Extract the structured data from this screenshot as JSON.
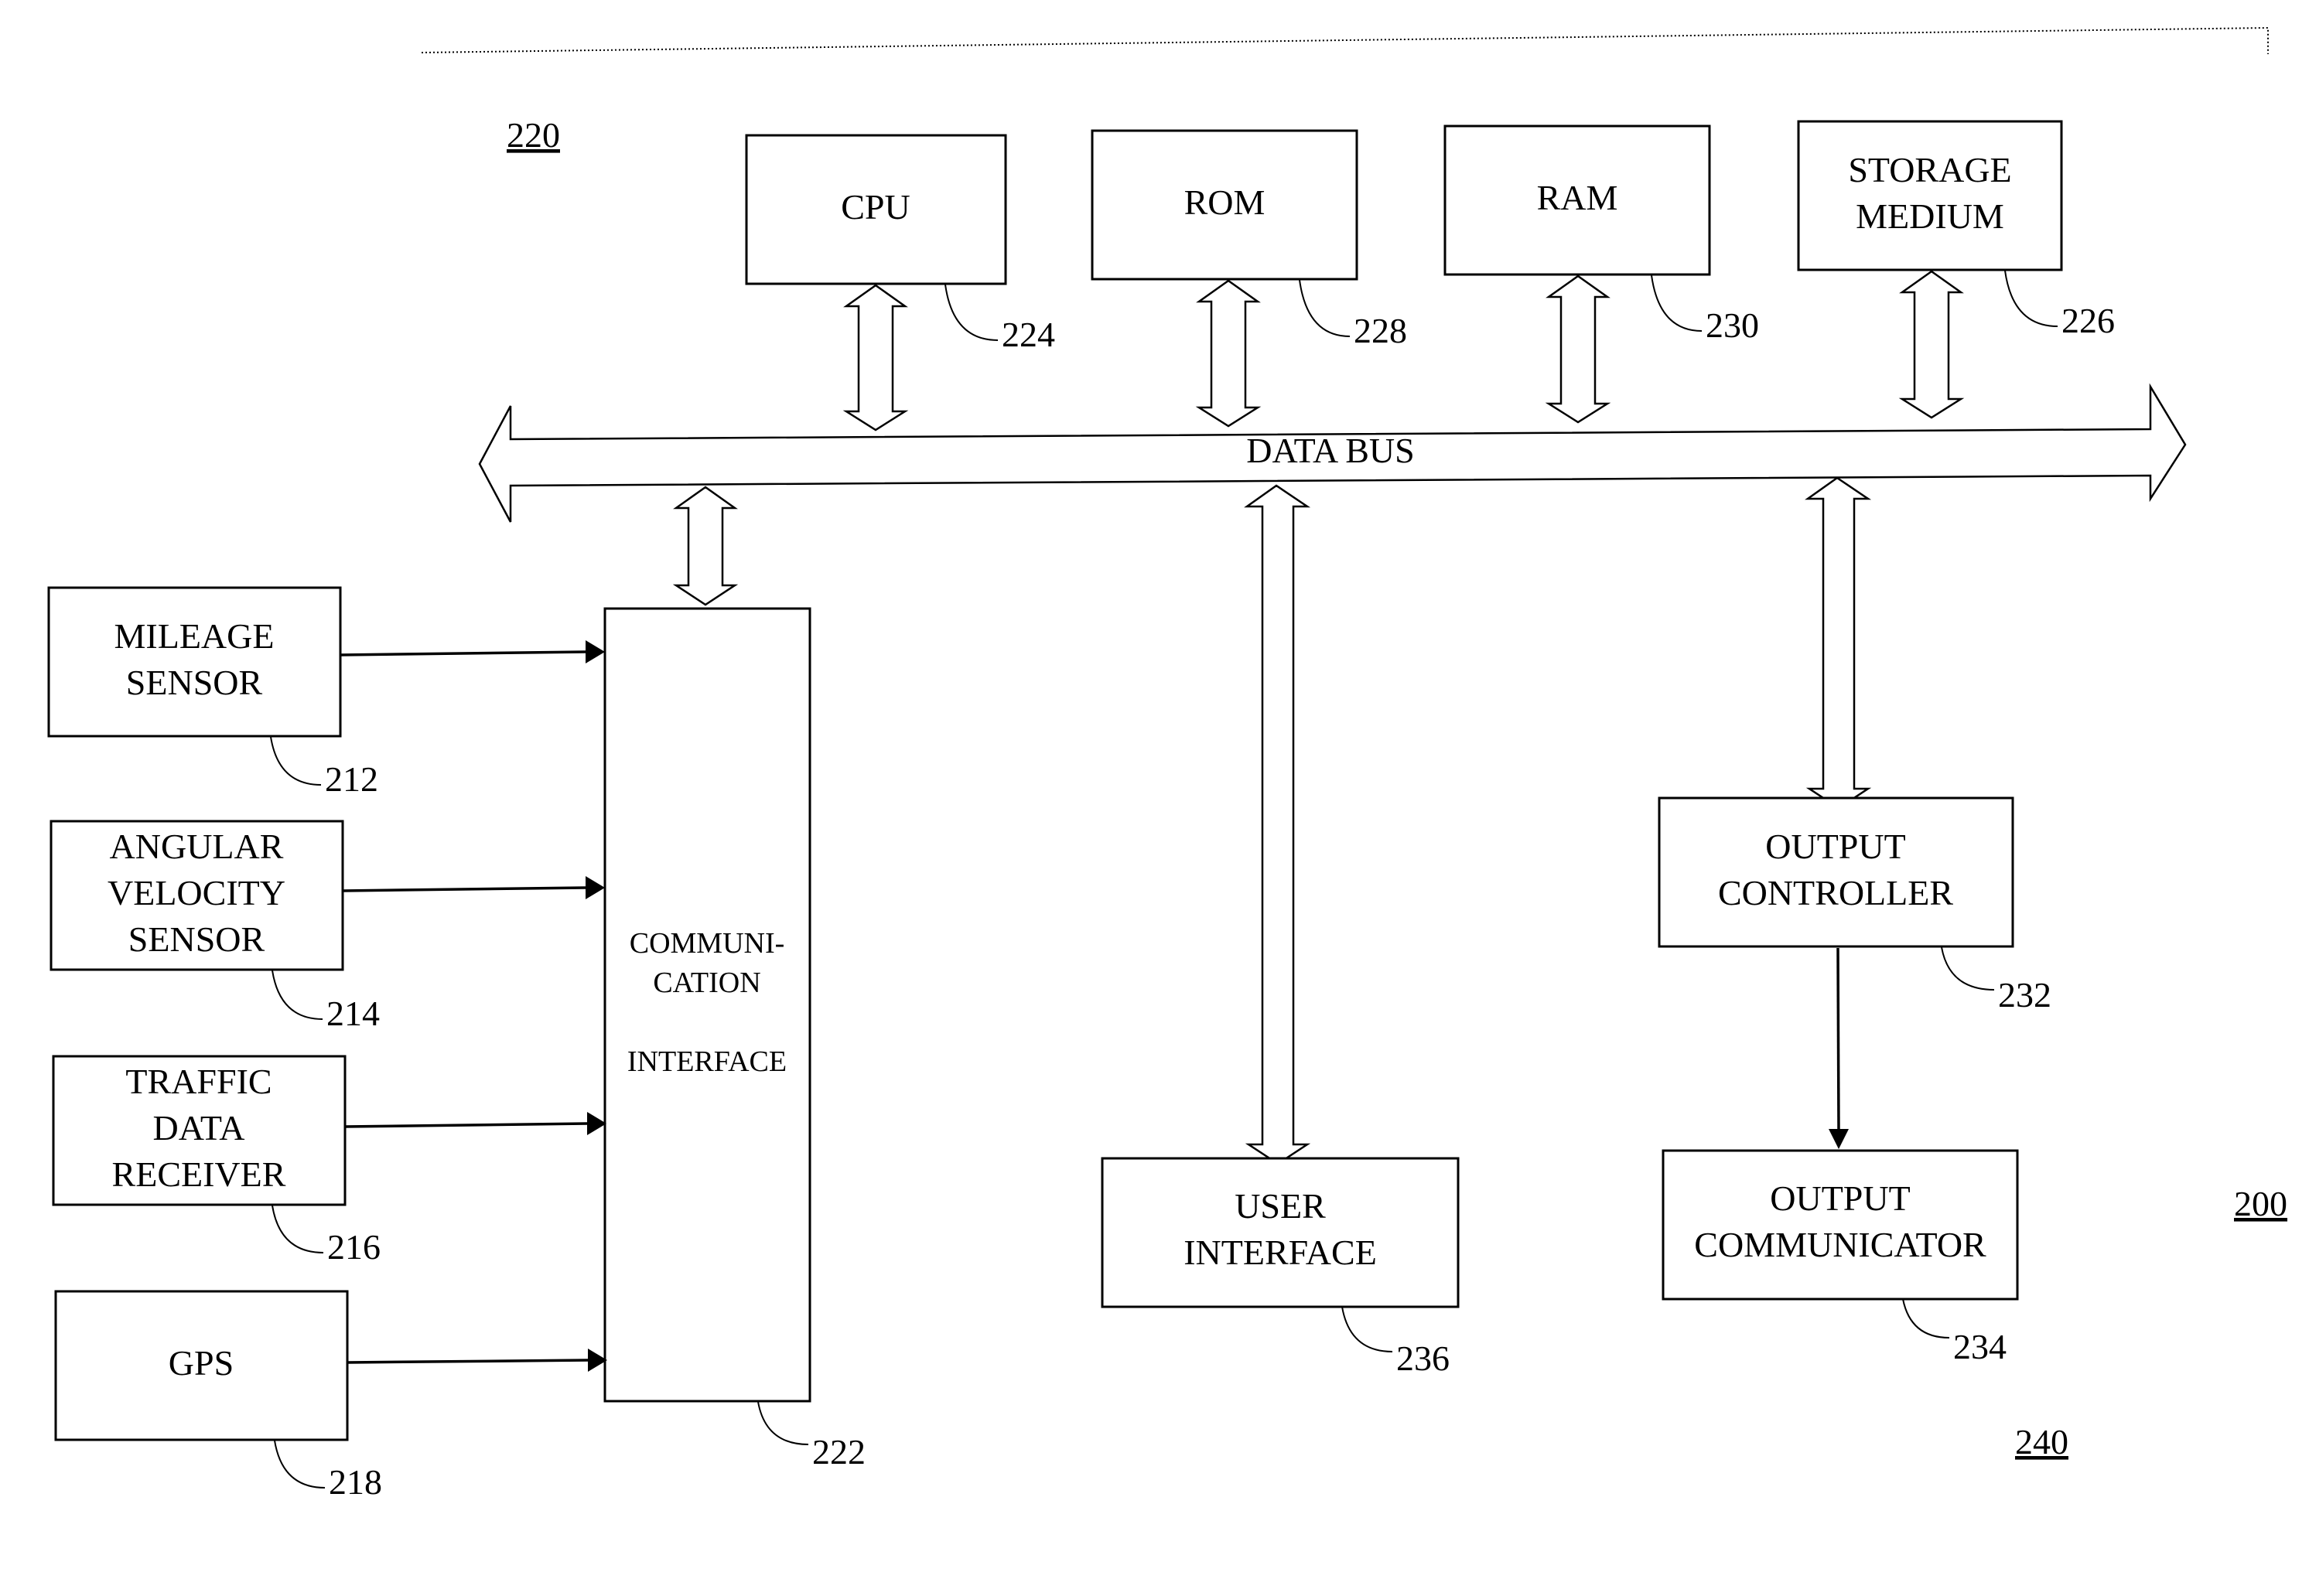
{
  "figure": {
    "system_ref": "200",
    "group_refs": {
      "processing_unit": "220",
      "output_unit": "240"
    },
    "data_bus": {
      "label": "DATA BUS"
    },
    "blocks": {
      "cpu": {
        "lines": [
          "CPU"
        ],
        "ref": "224"
      },
      "rom": {
        "lines": [
          "ROM"
        ],
        "ref": "228"
      },
      "ram": {
        "lines": [
          "RAM"
        ],
        "ref": "230"
      },
      "storage": {
        "lines": [
          "STORAGE",
          "MEDIUM"
        ],
        "ref": "226"
      },
      "mileage": {
        "lines": [
          "MILEAGE",
          "SENSOR"
        ],
        "ref": "212"
      },
      "angular": {
        "lines": [
          "ANGULAR",
          "VELOCITY",
          "SENSOR"
        ],
        "ref": "214"
      },
      "traffic": {
        "lines": [
          "TRAFFIC",
          "DATA",
          "RECEIVER"
        ],
        "ref": "216"
      },
      "gps": {
        "lines": [
          "GPS"
        ],
        "ref": "218"
      },
      "comm": {
        "lines": [
          "COMMUNI-",
          "CATION",
          "",
          "INTERFACE"
        ],
        "ref": "222"
      },
      "user_interface": {
        "lines": [
          "USER",
          "INTERFACE"
        ],
        "ref": "236"
      },
      "output_controller": {
        "lines": [
          "OUTPUT",
          "CONTROLLER"
        ],
        "ref": "232"
      },
      "output_communicator": {
        "lines": [
          "OUTPUT",
          "COMMUNICATOR"
        ],
        "ref": "234"
      }
    }
  }
}
